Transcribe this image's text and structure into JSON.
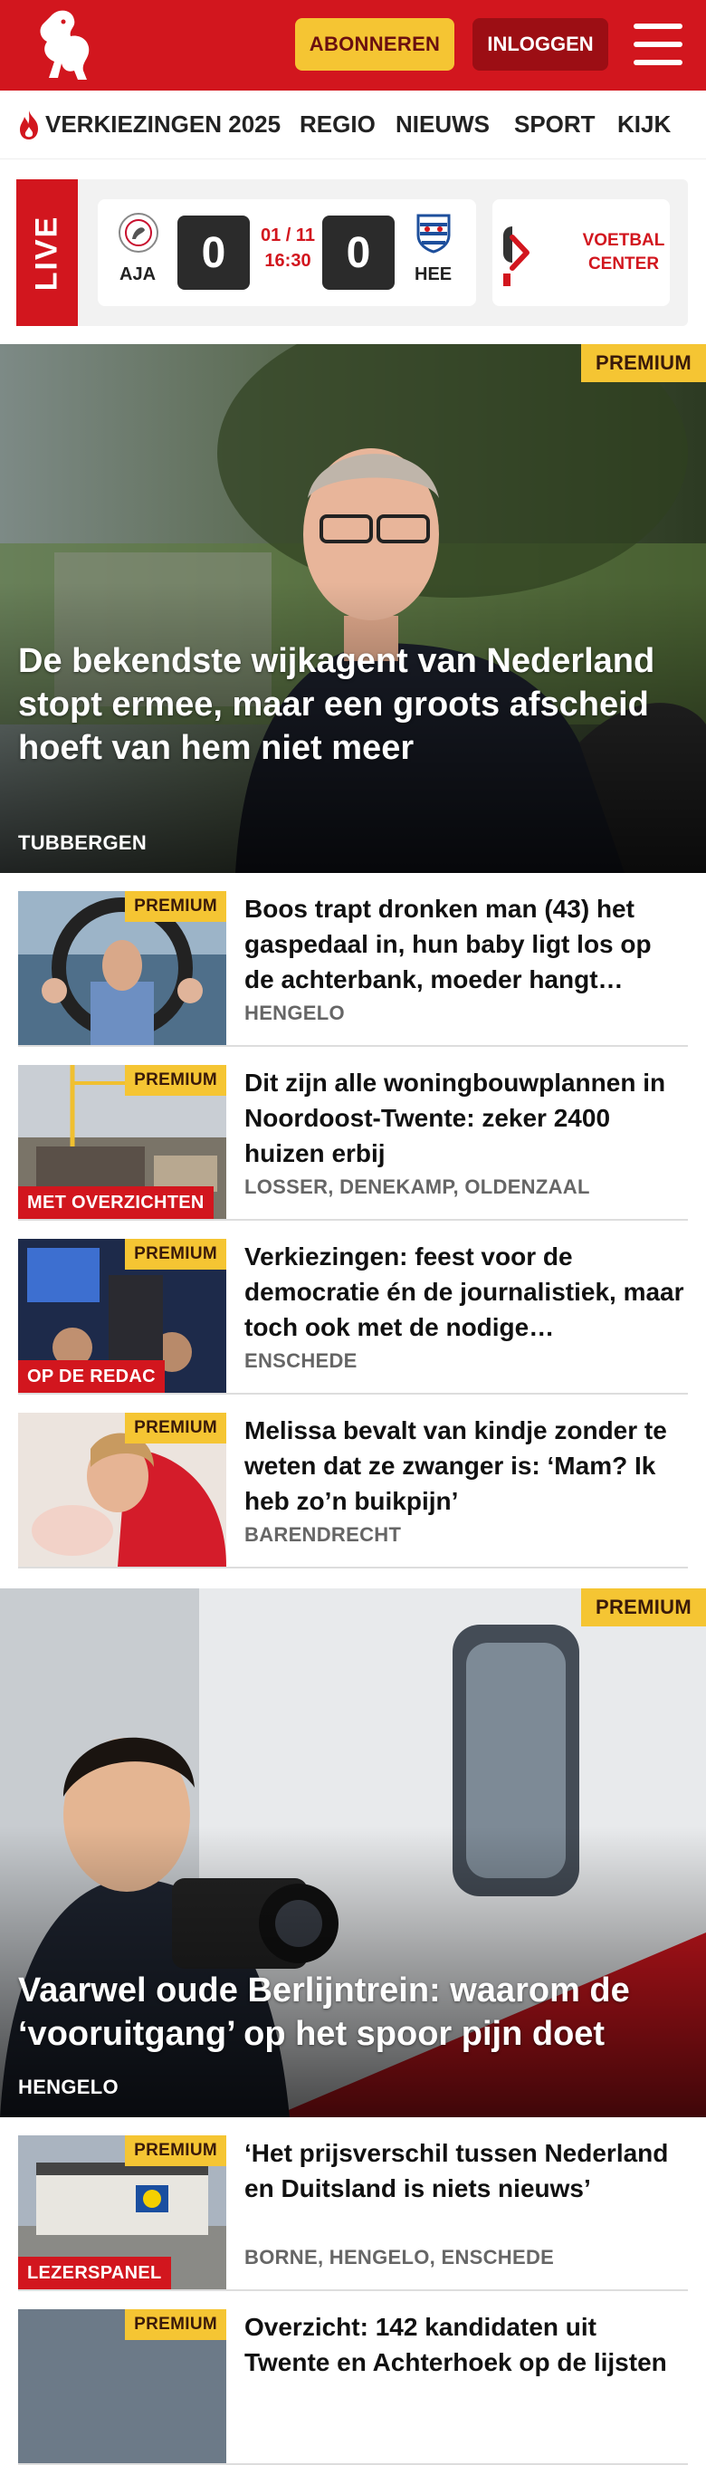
{
  "header": {
    "subscribe_label": "ABONNEREN",
    "login_label": "INLOGGEN",
    "brand_color": "#d2161e"
  },
  "nav": {
    "items": [
      "VERKIEZINGEN 2025",
      "REGIO",
      "NIEUWS",
      "SPORT",
      "KIJK"
    ]
  },
  "live": {
    "label": "LIVE",
    "match": {
      "home": "AJA",
      "away": "HEE",
      "home_score": "0",
      "away_score": "0",
      "date": "01 / 11",
      "time": "16:30"
    },
    "voetbal_center": "VOETBAL CENTER"
  },
  "articles": [
    {
      "premium": "PREMIUM",
      "title": "De bekendste wijkagent van Nederland stopt ermee, maar een groots afscheid hoeft van hem niet meer",
      "location": "TUBBERGEN"
    },
    {
      "premium": "PREMIUM",
      "title": "Boos trapt dronken man (43) het gaspedaal in, hun baby ligt los op de achterbank, moeder hangt…",
      "location": "HENGELO"
    },
    {
      "premium": "PREMIUM",
      "label": "MET OVERZICHTEN",
      "title": "Dit zijn alle woningbouwplannen in Noordoost-Twente: zeker 2400 huizen erbij",
      "location": "LOSSER, DENEKAMP, OLDENZAAL"
    },
    {
      "premium": "PREMIUM",
      "label": "OP DE REDAC",
      "title": "Verkiezingen: feest voor de democratie én de journalistiek, maar toch ook met de nodige…",
      "location": "ENSCHEDE"
    },
    {
      "premium": "PREMIUM",
      "title": "Melissa bevalt van kindje zonder te weten dat ze zwanger is: ‘Mam? Ik heb zo’n buikpijn’",
      "location": "BARENDRECHT"
    },
    {
      "premium": "PREMIUM",
      "title": "Vaarwel oude Berlijntrein: waarom de ‘vooruitgang’ op het spoor pijn doet",
      "location": "HENGELO"
    },
    {
      "premium": "PREMIUM",
      "label": "LEZERSPANEL",
      "title": "‘Het prijsverschil tussen Nederland en Duitsland is niets nieuws’",
      "location": "BORNE, HENGELO, ENSCHEDE"
    },
    {
      "premium": "PREMIUM",
      "title": "Overzicht: 142 kandidaten uit Twente en Achterhoek op de lijsten"
    }
  ]
}
